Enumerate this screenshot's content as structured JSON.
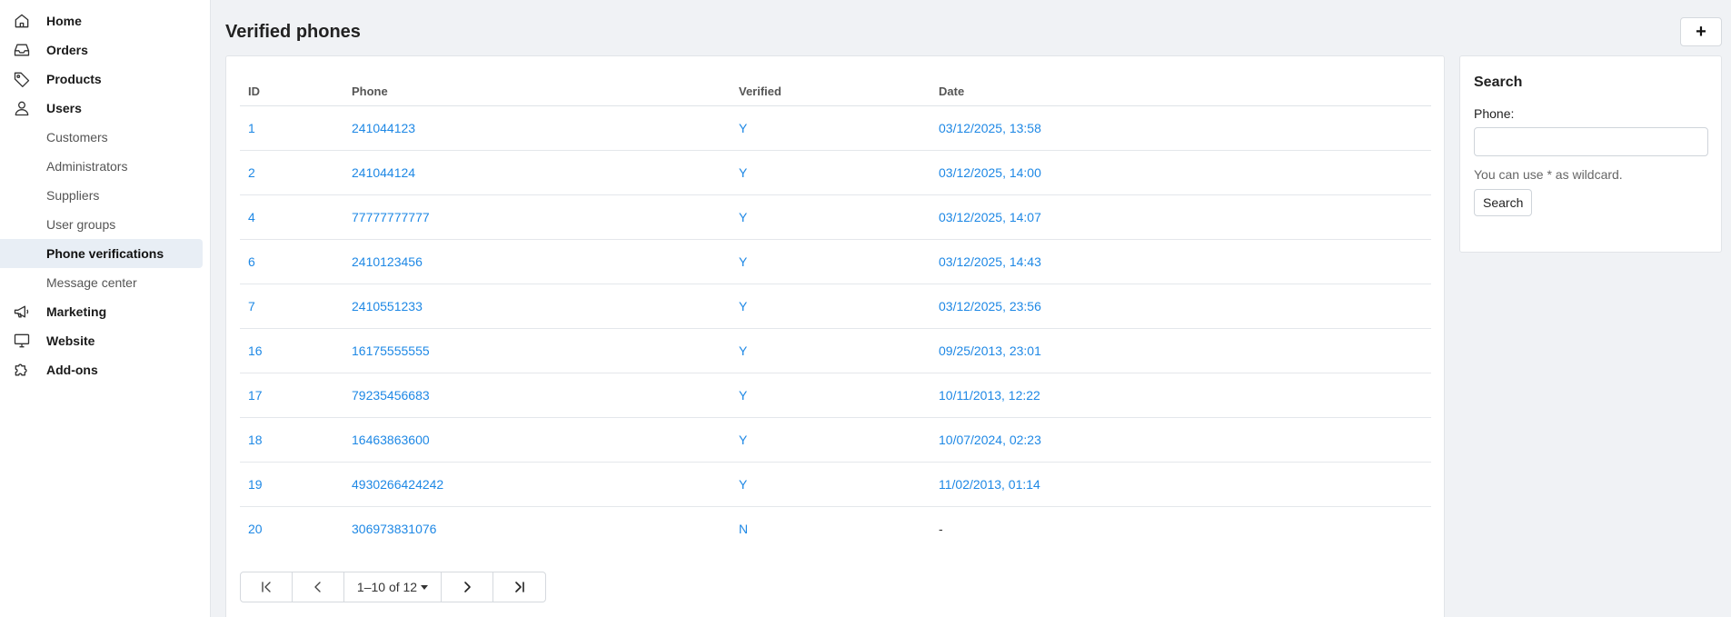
{
  "sidebar": {
    "main_items": {
      "home": "Home",
      "orders": "Orders",
      "products": "Products",
      "users": "Users",
      "marketing": "Marketing",
      "website": "Website",
      "addons": "Add-ons"
    },
    "users_sub": [
      {
        "label": "Customers"
      },
      {
        "label": "Administrators"
      },
      {
        "label": "Suppliers"
      },
      {
        "label": "User groups"
      },
      {
        "label": "Phone verifications",
        "active": true
      },
      {
        "label": "Message center"
      }
    ],
    "icons": [
      "home-icon",
      "inbox-icon",
      "tag-icon",
      "user-icon",
      "megaphone-icon",
      "monitor-icon",
      "puzzle-icon"
    ]
  },
  "header": {
    "title": "Verified phones",
    "add_label": "+"
  },
  "table": {
    "columns": [
      "ID",
      "Phone",
      "Verified",
      "Date"
    ],
    "rows": [
      {
        "id": "1",
        "phone": "241044123",
        "verified": "Y",
        "date": "03/12/2025, 13:58"
      },
      {
        "id": "2",
        "phone": "241044124",
        "verified": "Y",
        "date": "03/12/2025, 14:00"
      },
      {
        "id": "4",
        "phone": "77777777777",
        "verified": "Y",
        "date": "03/12/2025, 14:07"
      },
      {
        "id": "6",
        "phone": "2410123456",
        "verified": "Y",
        "date": "03/12/2025, 14:43"
      },
      {
        "id": "7",
        "phone": "2410551233",
        "verified": "Y",
        "date": "03/12/2025, 23:56"
      },
      {
        "id": "16",
        "phone": "16175555555",
        "verified": "Y",
        "date": "09/25/2013, 23:01"
      },
      {
        "id": "17",
        "phone": "79235456683",
        "verified": "Y",
        "date": "10/11/2013, 12:22"
      },
      {
        "id": "18",
        "phone": "16463863600",
        "verified": "Y",
        "date": "10/07/2024, 02:23"
      },
      {
        "id": "19",
        "phone": "4930266424242",
        "verified": "Y",
        "date": "11/02/2013, 01:14"
      },
      {
        "id": "20",
        "phone": "306973831076",
        "verified": "N",
        "date": "-"
      }
    ]
  },
  "pagination": {
    "range_label": "1–10 of 12"
  },
  "search": {
    "title": "Search",
    "phone_label": "Phone:",
    "phone_value": "",
    "hint": "You can use * as wildcard.",
    "button_label": "Search"
  },
  "colors": {
    "link": "#1e88e5",
    "active_bg": "#e8eef5",
    "page_bg": "#f0f2f5"
  }
}
